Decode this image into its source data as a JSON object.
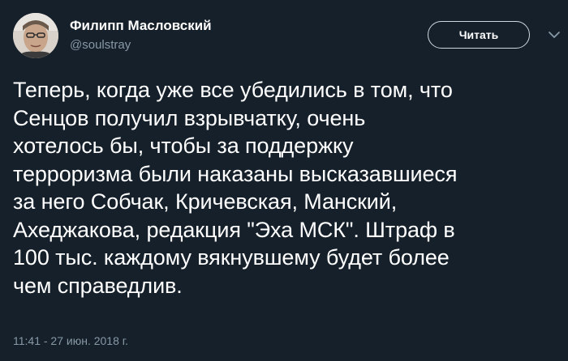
{
  "author": {
    "name": "Филипп Масловский",
    "handle": "@soulstray",
    "avatar_icon": "avatar-photo"
  },
  "follow_button": {
    "label": "Читать"
  },
  "menu": {
    "icon": "chevron-down-icon"
  },
  "tweet": {
    "lines": [
      "Теперь, когда уже все убедились в том, что",
      "Сенцов получил взрывчатку, очень",
      "хотелось бы, чтобы за поддержку",
      "терроризма были наказаны высказавшиеся",
      "за него Собчак, Кричевская, Манский,",
      "Ахеджакова, редакция \"Эха МСК\". Штраф в",
      "100 тыс. каждому вякнувшему будет более",
      "чем справедлив."
    ],
    "timestamp": "11:41 - 27 июн. 2018 г."
  },
  "colors": {
    "background": "#15202b",
    "text": "#ffffff",
    "secondary_text": "#8899a6",
    "button_border": "#cfd9de"
  }
}
